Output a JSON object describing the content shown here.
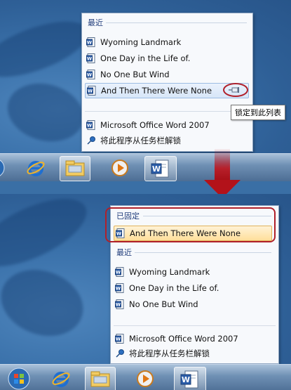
{
  "top": {
    "recent_header": "最近",
    "recent_items": [
      "Wyoming Landmark",
      "One Day in the Life of.",
      "No One But Wind",
      "And Then There Were None"
    ],
    "app_item": "Microsoft Office Word 2007",
    "unpin_item": "将此程序从任务栏解锁",
    "tooltip": "锁定到此列表"
  },
  "bottom": {
    "pinned_header": "已固定",
    "pinned_item": "And Then There Were None",
    "recent_header": "最近",
    "recent_items": [
      "Wyoming Landmark",
      "One Day in the Life of.",
      "No One But Wind"
    ],
    "app_item": "Microsoft Office Word 2007",
    "unpin_item": "将此程序从任务栏解锁"
  },
  "icons": {
    "doc": "word-document-icon",
    "pin": "pushpin-icon",
    "ie": "internet-explorer-icon",
    "explorer": "windows-explorer-icon",
    "media": "media-player-icon",
    "word": "word-icon",
    "start": "start-orb-icon",
    "arrow": "down-arrow-icon"
  },
  "colors": {
    "highlight_circle": "#b0202a",
    "arrow": "#c0141c"
  }
}
